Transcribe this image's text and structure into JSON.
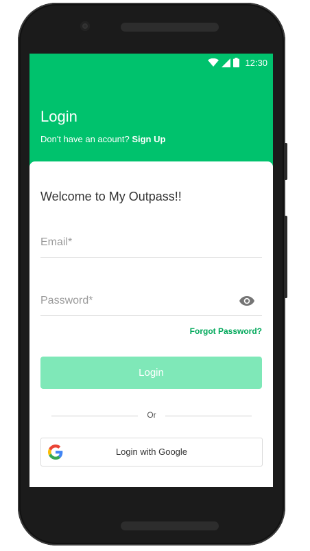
{
  "status_bar": {
    "time": "12:30"
  },
  "header": {
    "title": "Login",
    "subtitle_prefix": "Don't have an acount?",
    "signup_link": "Sign Up"
  },
  "card": {
    "welcome": "Welcome to My Outpass!!",
    "email": {
      "value": "",
      "placeholder": "Email*"
    },
    "password": {
      "value": "",
      "placeholder": "Password*"
    },
    "forgot_password": "Forgot Password?",
    "login_button": "Login",
    "divider_text": "Or",
    "google_button": "Login with Google"
  },
  "colors": {
    "brand_green": "#00c26d",
    "link_green": "#00a85a",
    "button_disabled_green": "#7fe8b8"
  },
  "icons": [
    "wifi-icon",
    "signal-icon",
    "battery-icon",
    "eye-icon",
    "google-logo-icon"
  ]
}
